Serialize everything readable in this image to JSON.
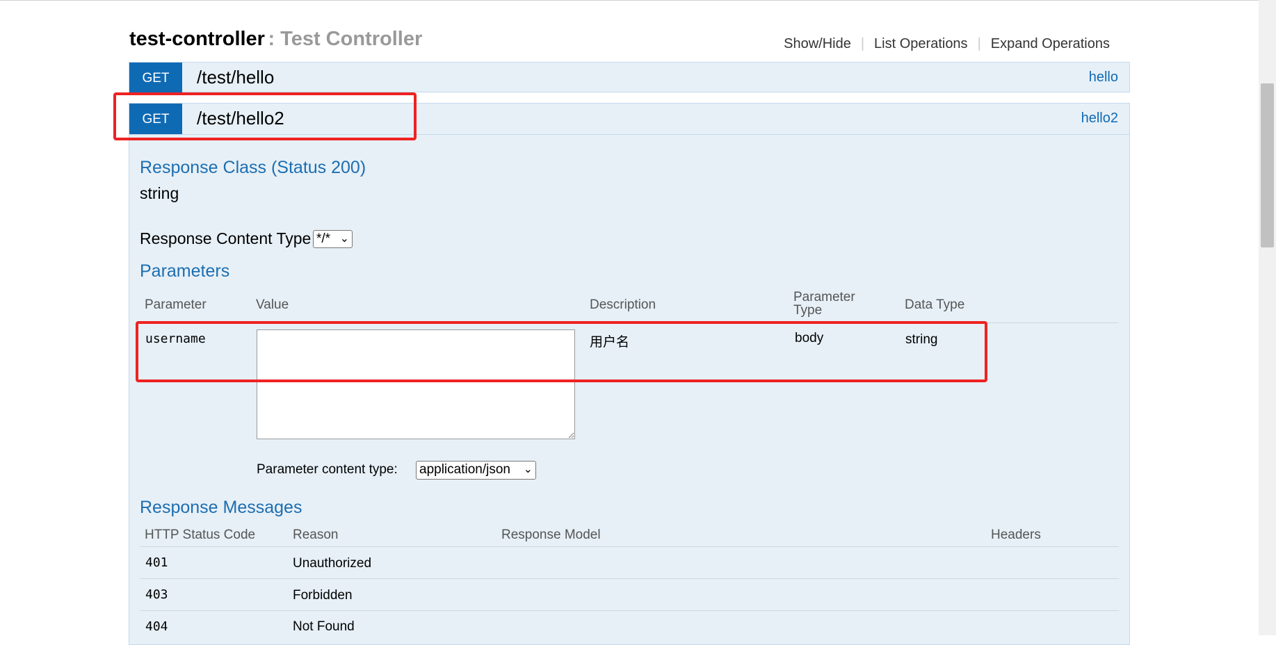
{
  "header": {
    "title": "test-controller",
    "subtitle": ": Test Controller",
    "links": [
      "Show/Hide",
      "List Operations",
      "Expand Operations"
    ]
  },
  "ops": [
    {
      "verb": "GET",
      "path": "/test/hello",
      "nick": "hello"
    },
    {
      "verb": "GET",
      "path": "/test/hello2",
      "nick": "hello2"
    }
  ],
  "details": {
    "response_class_title": "Response Class (Status 200)",
    "response_class_value": "string",
    "response_content_type_label": "Response Content Type",
    "response_content_type_value": "*/*",
    "parameters_title": "Parameters",
    "param_headers": [
      "Parameter",
      "Value",
      "Description",
      "Parameter\nType",
      "Data Type"
    ],
    "param": {
      "name": "username",
      "value": "",
      "description": "用户名",
      "param_type": "body",
      "data_type": "string"
    },
    "param_content_type_label": "Parameter content type:",
    "param_content_type_value": "application/json",
    "response_messages_title": "Response Messages",
    "resp_headers": [
      "HTTP Status Code",
      "Reason",
      "Response Model",
      "Headers"
    ],
    "resp_rows": [
      {
        "code": "401",
        "reason": "Unauthorized"
      },
      {
        "code": "403",
        "reason": "Forbidden"
      },
      {
        "code": "404",
        "reason": "Not Found"
      }
    ]
  },
  "colors": {
    "accent": "#0f6ab4",
    "panel_bg": "#e7f0f7",
    "highlight": "#ee2222"
  }
}
